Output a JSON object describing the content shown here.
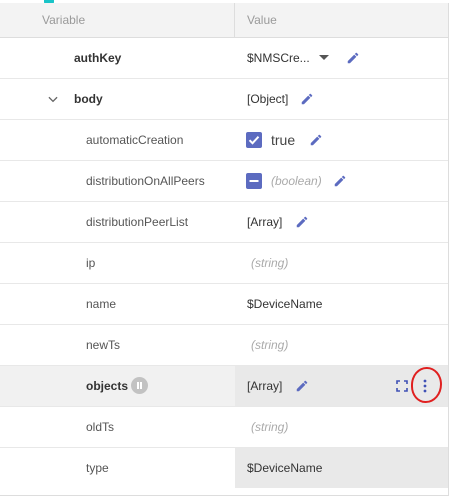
{
  "header": {
    "variable_label": "Variable",
    "value_label": "Value"
  },
  "rows": [
    {
      "name": "authKey",
      "value": "$NMSCre...",
      "type": "dropdown"
    },
    {
      "name": "body",
      "value": "[Object]",
      "type": "object"
    },
    {
      "name": "automaticCreation",
      "value": "true",
      "type": "boolean-checked"
    },
    {
      "name": "distributionOnAllPeers",
      "value": "(boolean)",
      "type": "boolean-indeterminate"
    },
    {
      "name": "distributionPeerList",
      "value": "[Array]",
      "type": "array"
    },
    {
      "name": "ip",
      "value": "(string)",
      "type": "placeholder"
    },
    {
      "name": "name",
      "value": "$DeviceName",
      "type": "text"
    },
    {
      "name": "newTs",
      "value": "(string)",
      "type": "placeholder"
    },
    {
      "name": "objects",
      "value": "[Array]",
      "type": "array-selected"
    },
    {
      "name": "oldTs",
      "value": "(string)",
      "type": "placeholder"
    },
    {
      "name": "type",
      "value": "$DeviceName",
      "type": "text-shaded"
    }
  ],
  "icons": {
    "edit": "pencil-icon",
    "expand": "chevron-down-icon",
    "fullscreen": "expand-icon",
    "more": "more-vert-icon",
    "info": "info-icon"
  },
  "colors": {
    "accent": "#5c6bc0",
    "highlight_circle": "#e02020",
    "top_marker": "#19c4c8"
  }
}
